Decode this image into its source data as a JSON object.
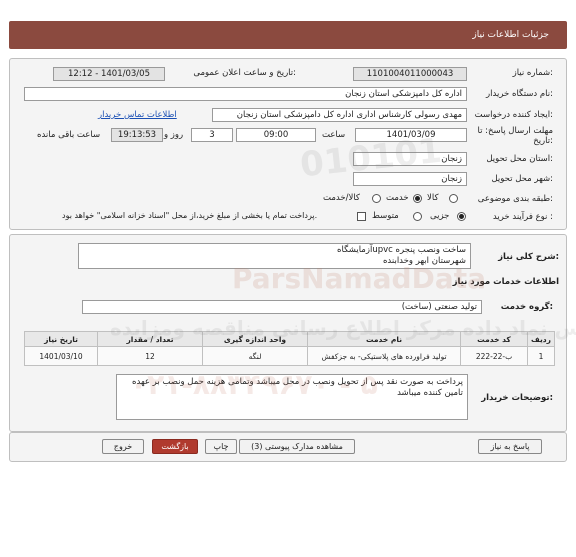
{
  "header": {
    "title": "جزئیات اطلاعات نیاز"
  },
  "info": {
    "need_number_label": "شماره نیاز:",
    "need_number": "1101004011000043",
    "announce_label": "تاریخ و ساعت اعلان عمومی:",
    "announce_value": "1401/03/05 - 12:12",
    "buyer_org_label": "نام دستگاه خریدار:",
    "buyer_org": "اداره کل دامپزشکی استان زنجان",
    "creator_label": "ایجاد کننده درخواست:",
    "creator": "مهدی رسولی کارشناس اداری اداره کل دامپزشکی استان زنجان",
    "contact_link": "اطلاعات تماس خریدار",
    "deadline_label": "مهلت ارسال پاسخ: تا",
    "deadline_label2": "تاریخ:",
    "deadline_date": "1401/03/09",
    "time_label": "ساعت",
    "deadline_time": "09:00",
    "days": "3",
    "day_label": "روز و",
    "remaining_time": "19:13:53",
    "remaining_label": "ساعت باقی مانده",
    "province_label": "استان محل تحویل:",
    "province": "زنجان",
    "city_label": "شهر محل تحویل:",
    "city": "زنجان",
    "category_label": "طبقه بندی موضوعی:",
    "category_options": [
      "کالا",
      "خدمت",
      "کالا/خدمت"
    ],
    "category_selected": "خدمت",
    "process_label": "نوع فرآیند خرید :",
    "process_options": [
      "جزیی",
      "متوسط"
    ],
    "process_selected": "جزیی",
    "payment_note": "پرداخت تمام یا بخشی از مبلغ خرید،از محل \"اسناد خزانه اسلامی\" خواهد بود."
  },
  "details": {
    "summary_label": "شرح کلی نیاز:",
    "summary_line1": "ساخت ونصب پنجره upvcآزمایشگاه",
    "summary_line2": "شهرستان ابهر وخدابنده",
    "services_title": "اطلاعات خدمات مورد نیاز",
    "group_label": "گروه خدمت:",
    "group_value": "تولید صنعتی (ساخت)",
    "table": {
      "headers": [
        "ردیف",
        "کد خدمت",
        "نام خدمت",
        "واحد اندازه گیری",
        "تعداد / مقدار",
        "تاریخ نیاز"
      ],
      "rows": [
        [
          "1",
          "ب-22-222",
          "تولید فراورده های پلاستیکی- به جزکفش",
          "لنگه",
          "12",
          "1401/03/10"
        ]
      ]
    },
    "buyer_notes_label": "توضیحات خریدار:",
    "buyer_notes": "پرداخت به صورت نقد پس از تحویل ونصب در محل میباشد وتمامی هزینه حمل ونصب بر عهده تامین کننده میباشد"
  },
  "buttons": {
    "reply": "پاسخ به نیاز",
    "attachments": "مشاهده مدارک پیوستی (3)",
    "print": "چاپ",
    "back": "بازگشت",
    "exit": "خروج"
  },
  "watermark": {
    "brand": "ParsNamadData",
    "tagline": "پارس نماد داده مرکز اطلاع رسانی مناقصه ومزایده",
    "phone": "۰۲۱-۸۸۳۴۹۶۷۰ - ۵",
    "digits": "010101"
  }
}
